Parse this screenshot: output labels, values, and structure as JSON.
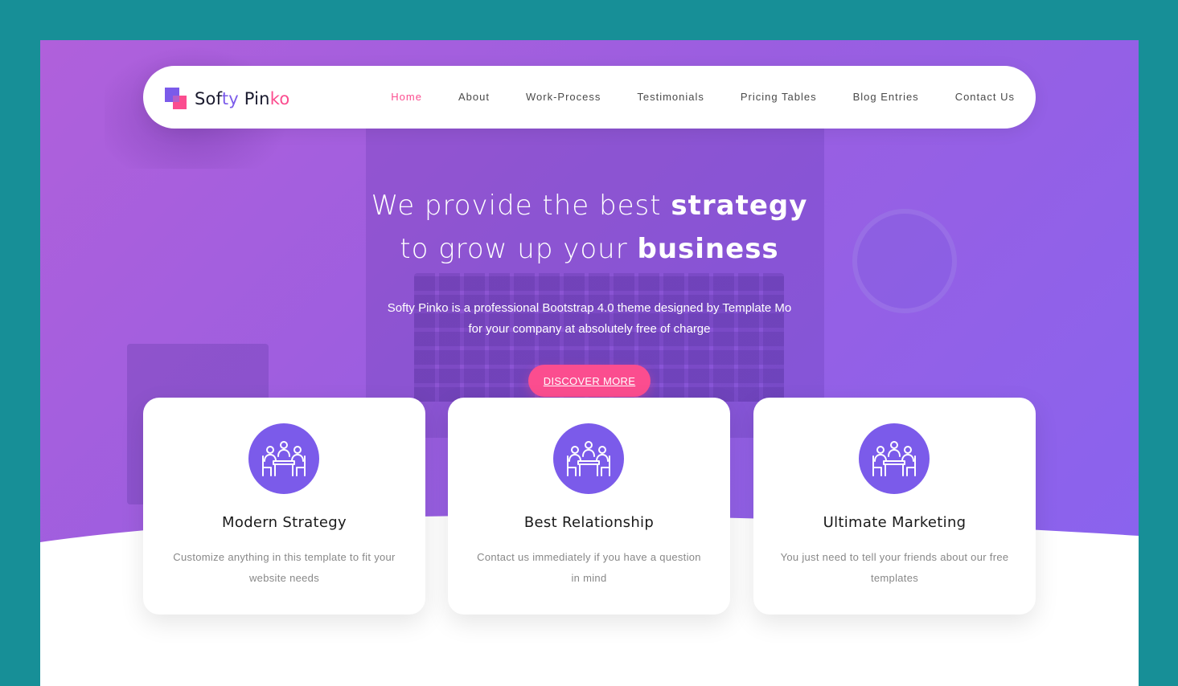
{
  "brand": {
    "part1": "Sof",
    "part2": "ty",
    "part3": " Pin",
    "part4": "ko"
  },
  "nav": {
    "items": [
      {
        "label": "Home",
        "active": true
      },
      {
        "label": "About",
        "active": false
      },
      {
        "label": "Work-Process",
        "active": false
      },
      {
        "label": "Testimonials",
        "active": false
      },
      {
        "label": "Pricing Tables",
        "active": false
      },
      {
        "label": "Blog Entries",
        "active": false
      },
      {
        "label": "Contact Us",
        "active": false
      }
    ]
  },
  "hero": {
    "headline_line1_plain": "We provide the best ",
    "headline_line1_bold": "strategy",
    "headline_line2_plain": "to grow up your ",
    "headline_line2_bold": "business",
    "subtext_line1": "Softy Pinko is a professional Bootstrap 4.0 theme designed by Template Mo",
    "subtext_line2": "for your company at absolutely free of charge",
    "cta_label": "DISCOVER MORE"
  },
  "features": [
    {
      "icon": "meeting-icon",
      "title": "Modern Strategy",
      "description": "Customize anything in this template to fit your website needs"
    },
    {
      "icon": "meeting-icon",
      "title": "Best Relationship",
      "description": "Contact us immediately if you have a question in mind"
    },
    {
      "icon": "meeting-icon",
      "title": "Ultimate Marketing",
      "description": "You just need to tell your friends about our free templates"
    }
  ],
  "colors": {
    "outer_background": "#178f97",
    "hero_gradient_start": "#b060db",
    "hero_gradient_end": "#8a63ee",
    "accent_pink": "#fb4d8f",
    "accent_purple": "#7b5bea"
  }
}
